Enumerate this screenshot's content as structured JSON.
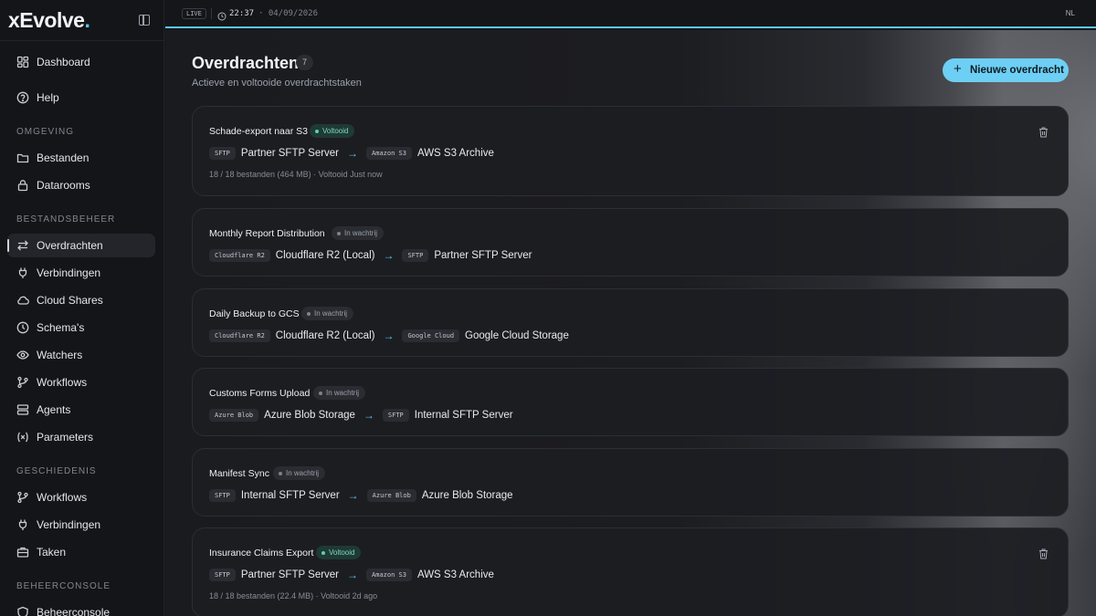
{
  "brand": {
    "name": "xEvolve",
    "dot": "."
  },
  "topbar": {
    "live": "LIVE",
    "time": "22:37",
    "date": "· 04/09/2026",
    "lang": "NL"
  },
  "sidebar": {
    "top_items": [
      {
        "label": "Dashboard",
        "icon": "grid-icon"
      },
      {
        "label": "Help",
        "icon": "help-icon"
      }
    ],
    "sections": [
      {
        "title": "OMGEVING",
        "items": [
          {
            "label": "Bestanden",
            "icon": "folder-icon"
          },
          {
            "label": "Datarooms",
            "icon": "lock-icon"
          }
        ]
      },
      {
        "title": "BESTANDSBEHEER",
        "items": [
          {
            "label": "Overdrachten",
            "icon": "transfer-icon",
            "active": true
          },
          {
            "label": "Verbindingen",
            "icon": "plug-icon"
          },
          {
            "label": "Cloud Shares",
            "icon": "cloud-icon"
          },
          {
            "label": "Schema's",
            "icon": "clock-icon"
          },
          {
            "label": "Watchers",
            "icon": "eye-icon"
          },
          {
            "label": "Workflows",
            "icon": "branch-icon"
          },
          {
            "label": "Agents",
            "icon": "server-icon"
          },
          {
            "label": "Parameters",
            "icon": "variable-icon"
          }
        ]
      },
      {
        "title": "GESCHIEDENIS",
        "items": [
          {
            "label": "Workflows",
            "icon": "branch-icon"
          },
          {
            "label": "Verbindingen",
            "icon": "plug-icon"
          },
          {
            "label": "Taken",
            "icon": "briefcase-icon"
          }
        ]
      },
      {
        "title": "BEHEERCONSOLE",
        "items": [
          {
            "label": "Beheerconsole",
            "icon": "shield-icon"
          }
        ]
      }
    ]
  },
  "main": {
    "title": "Overdrachten",
    "count": "7",
    "subtitle": "Actieve en voltooide overdrachtstaken",
    "new_button": "Nieuwe overdracht",
    "transfers": [
      {
        "name": "Schade-export naar S3",
        "status": "Voltooid",
        "status_type": "done",
        "src_chip": "SFTP",
        "src": "Partner SFTP Server",
        "dst_chip": "Amazon S3",
        "dst": "AWS S3 Archive",
        "meta": "18 / 18 bestanden (464 MB) · Voltooid Just now"
      },
      {
        "name": "Monthly Report Distribution",
        "status": "In wachtrij",
        "status_type": "queued",
        "src_chip": "Cloudflare R2",
        "src": "Cloudflare R2 (Local)",
        "dst_chip": "SFTP",
        "dst": "Partner SFTP Server"
      },
      {
        "name": "Daily Backup to GCS",
        "status": "In wachtrij",
        "status_type": "queued",
        "src_chip": "Cloudflare R2",
        "src": "Cloudflare R2 (Local)",
        "dst_chip": "Google Cloud",
        "dst": "Google Cloud Storage"
      },
      {
        "name": "Customs Forms Upload",
        "status": "In wachtrij",
        "status_type": "queued",
        "src_chip": "Azure Blob",
        "src": "Azure Blob Storage",
        "dst_chip": "SFTP",
        "dst": "Internal SFTP Server"
      },
      {
        "name": "Manifest Sync",
        "status": "In wachtrij",
        "status_type": "queued",
        "src_chip": "SFTP",
        "src": "Internal SFTP Server",
        "dst_chip": "Azure Blob",
        "dst": "Azure Blob Storage"
      },
      {
        "name": "Insurance Claims Export",
        "status": "Voltooid",
        "status_type": "done",
        "src_chip": "SFTP",
        "src": "Partner SFTP Server",
        "dst_chip": "Amazon S3",
        "dst": "AWS S3 Archive",
        "meta": "18 / 18 bestanden (22.4 MB) · Voltooid 2d ago"
      }
    ]
  }
}
